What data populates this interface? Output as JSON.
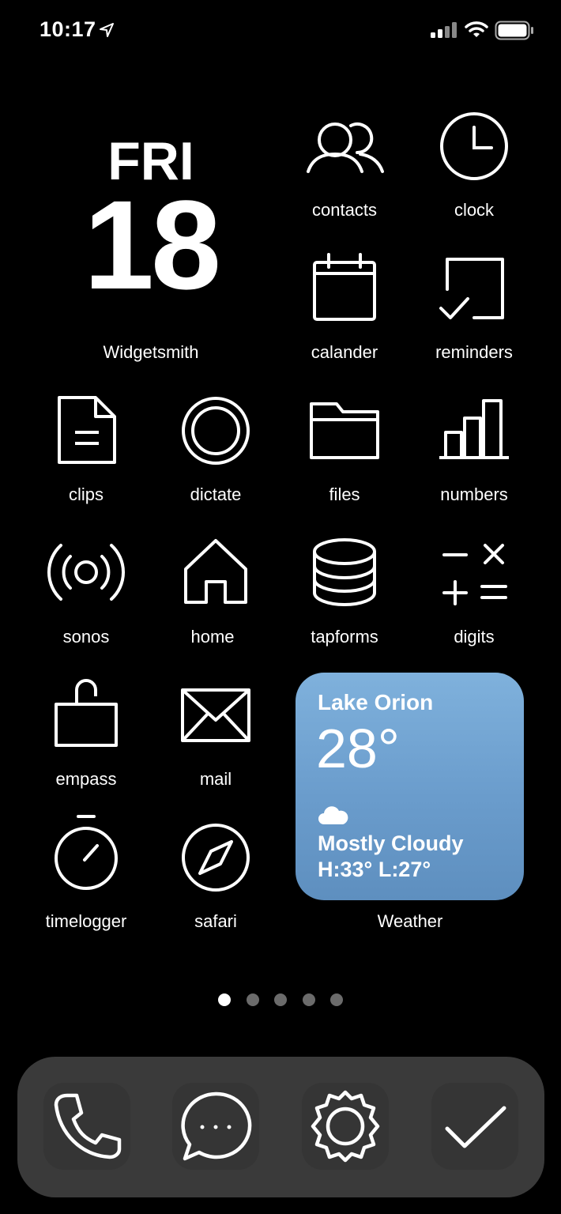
{
  "status_bar": {
    "time": "10:17"
  },
  "widgetsmith": {
    "day": "FRI",
    "date": "18",
    "label": "Widgetsmith"
  },
  "apps": {
    "contacts": "contacts",
    "clock": "clock",
    "calander": "calander",
    "reminders": "reminders",
    "clips": "clips",
    "dictate": "dictate",
    "files": "files",
    "numbers": "numbers",
    "sonos": "sonos",
    "home": "home",
    "tapforms": "tapforms",
    "digits": "digits",
    "empass": "empass",
    "mail": "mail",
    "timelogger": "timelogger",
    "safari": "safari"
  },
  "weather": {
    "location": "Lake Orion",
    "temp": "28°",
    "condition": "Mostly Cloudy",
    "high_low": "H:33° L:27°",
    "label": "Weather",
    "icon": "cloud-icon"
  },
  "page_dots": {
    "count": 5,
    "active": 1
  },
  "dock": [
    "phone-icon",
    "messages-icon",
    "settings-icon",
    "checkmark-icon"
  ],
  "colors": {
    "background": "#000000",
    "dock": "#3a3a3a",
    "weather_top": "#7fb1dc",
    "weather_bottom": "#5e8fbf"
  }
}
